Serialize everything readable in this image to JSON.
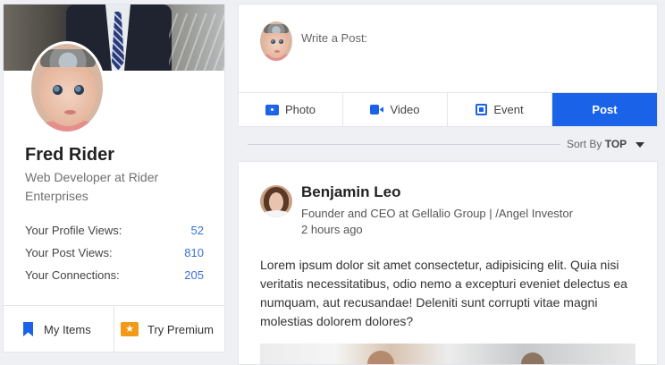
{
  "profile": {
    "name": "Fred Rider",
    "title": "Web Developer at Rider Enterprises",
    "stats": [
      {
        "label": "Your Profile Views:",
        "value": "52"
      },
      {
        "label": "Your Post Views:",
        "value": "810"
      },
      {
        "label": "Your Connections:",
        "value": "205"
      }
    ],
    "footer": {
      "my_items": "My Items",
      "try_premium": "Try Premium"
    }
  },
  "composer": {
    "placeholder": "Write a Post:",
    "actions": {
      "photo": "Photo",
      "video": "Video",
      "event": "Event",
      "post": "Post"
    }
  },
  "sort": {
    "label": "Sort By",
    "value": "TOP"
  },
  "post": {
    "author": "Benjamin Leo",
    "role": "Founder and CEO at Gellalio Group | /Angel Investor",
    "time": "2 hours ago",
    "body": "Lorem ipsum dolor sit amet consectetur, adipisicing elit. Quia nisi veritatis necessitatibus, odio nemo a excepturi eveniet delectus ea numquam, aut recusandae! Deleniti sunt corrupti vitae magni molestias dolorem dolores?"
  },
  "colors": {
    "accent": "#1a62e8",
    "premium": "#f29a18",
    "stat_value": "#3a6fd8",
    "background": "#eef0f4"
  },
  "icons": {
    "my_items": "bookmark-icon",
    "try_premium": "star-icon",
    "photo": "camera-icon",
    "video": "video-camera-icon",
    "event": "calendar-icon",
    "sort": "caret-down-icon"
  }
}
